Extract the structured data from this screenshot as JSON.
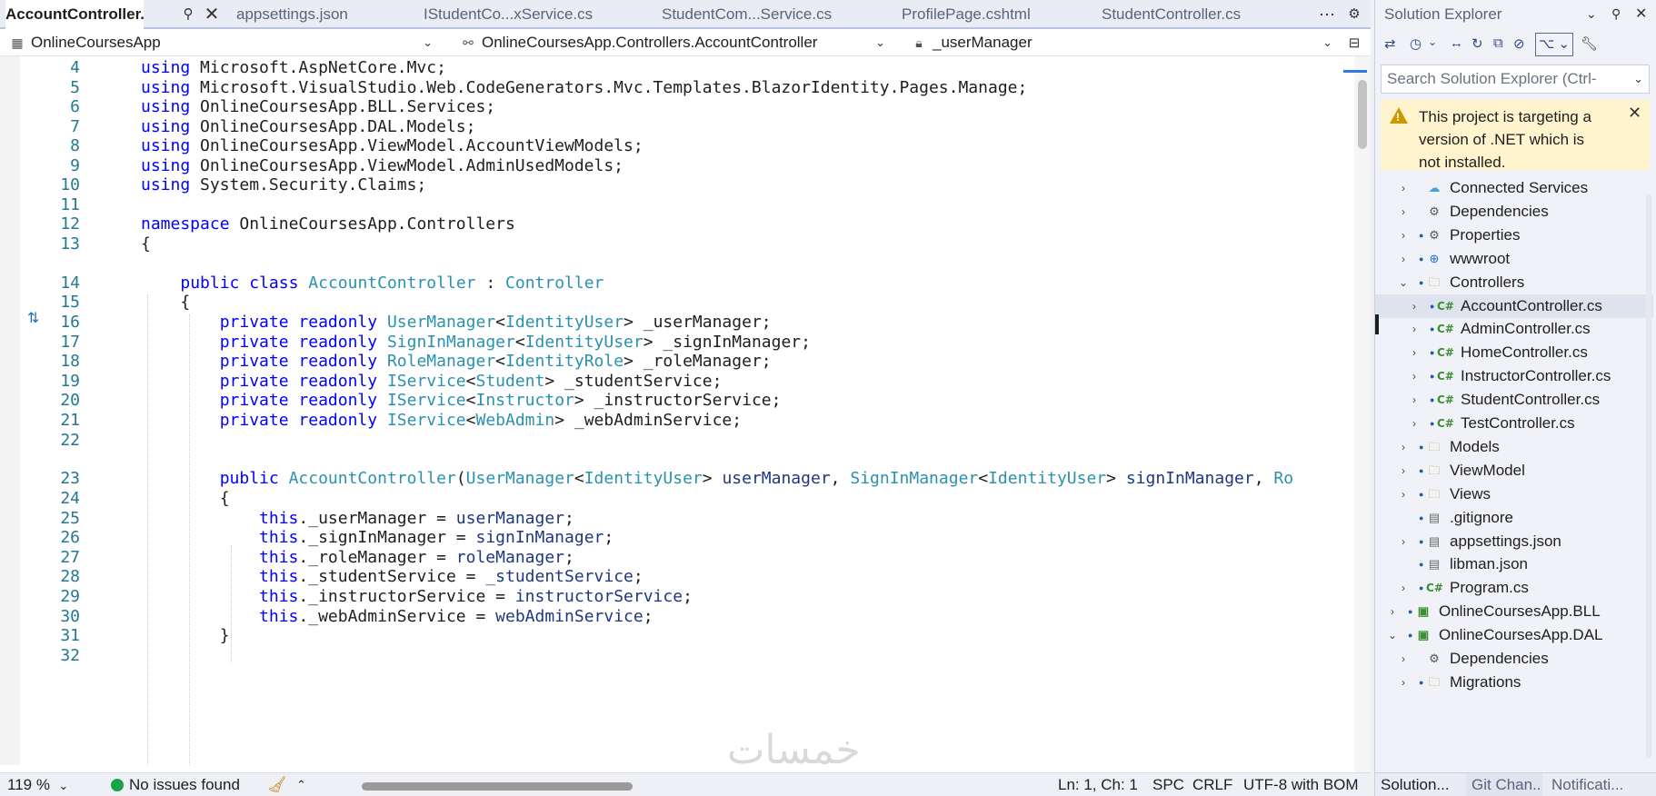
{
  "tabs": {
    "items": [
      {
        "label": "AccountController.cs",
        "active": true
      },
      {
        "label": "appsettings.json"
      },
      {
        "label": "IStudentCo...xService.cs"
      },
      {
        "label": "StudentCom...Service.cs"
      },
      {
        "label": "ProfilePage.cshtml"
      },
      {
        "label": "StudentController.cs"
      }
    ],
    "pin_icon": "pin-icon",
    "close_icon": "close-icon",
    "overflow_icon": "ellipsis-icon",
    "settings_icon": "gear-icon"
  },
  "nav": {
    "project": "OnlineCoursesApp",
    "type": "OnlineCoursesApp.Controllers.AccountController",
    "member": "_userManager"
  },
  "code": {
    "lines": [
      {
        "n": "4",
        "tokens": [
          [
            "kw",
            "using"
          ],
          [
            "pl",
            " Microsoft.AspNetCore.Mvc;"
          ]
        ]
      },
      {
        "n": "5",
        "tokens": [
          [
            "kw",
            "using"
          ],
          [
            "pl",
            " Microsoft.VisualStudio.Web.CodeGenerators.Mvc.Templates.BlazorIdentity.Pages.Manage;"
          ]
        ]
      },
      {
        "n": "6",
        "tokens": [
          [
            "kw",
            "using"
          ],
          [
            "pl",
            " OnlineCoursesApp.BLL.Services;"
          ]
        ]
      },
      {
        "n": "7",
        "tokens": [
          [
            "kw",
            "using"
          ],
          [
            "pl",
            " OnlineCoursesApp.DAL.Models;"
          ]
        ]
      },
      {
        "n": "8",
        "tokens": [
          [
            "kw",
            "using"
          ],
          [
            "pl",
            " OnlineCoursesApp.ViewModel.AccountViewModels;"
          ]
        ]
      },
      {
        "n": "9",
        "tokens": [
          [
            "kw",
            "using"
          ],
          [
            "pl",
            " OnlineCoursesApp.ViewModel.AdminUsedModels;"
          ]
        ]
      },
      {
        "n": "10",
        "tokens": [
          [
            "kw",
            "using"
          ],
          [
            "pl",
            " System.Security.Claims;"
          ]
        ]
      },
      {
        "n": "11",
        "tokens": []
      },
      {
        "n": "12",
        "tokens": [
          [
            "kw",
            "namespace"
          ],
          [
            "pl",
            " OnlineCoursesApp.Controllers"
          ]
        ]
      },
      {
        "n": "13",
        "tokens": [
          [
            "pl",
            "{"
          ]
        ]
      },
      {
        "n": "14",
        "tokens": [
          [
            "pl",
            "    "
          ],
          [
            "kw",
            "public"
          ],
          [
            "pl",
            " "
          ],
          [
            "kw",
            "class"
          ],
          [
            "pl",
            " "
          ],
          [
            "ty",
            "AccountController"
          ],
          [
            "pl",
            " : "
          ],
          [
            "ty",
            "Controller"
          ]
        ]
      },
      {
        "n": "15",
        "tokens": [
          [
            "pl",
            "    {"
          ]
        ]
      },
      {
        "n": "16",
        "tokens": [
          [
            "pl",
            "        "
          ],
          [
            "kw",
            "private"
          ],
          [
            "pl",
            " "
          ],
          [
            "kw",
            "readonly"
          ],
          [
            "pl",
            " "
          ],
          [
            "ty",
            "UserManager"
          ],
          [
            "pl",
            "<"
          ],
          [
            "ty",
            "IdentityUser"
          ],
          [
            "pl",
            "> _userManager;"
          ]
        ]
      },
      {
        "n": "17",
        "tokens": [
          [
            "pl",
            "        "
          ],
          [
            "kw",
            "private"
          ],
          [
            "pl",
            " "
          ],
          [
            "kw",
            "readonly"
          ],
          [
            "pl",
            " "
          ],
          [
            "ty",
            "SignInManager"
          ],
          [
            "pl",
            "<"
          ],
          [
            "ty",
            "IdentityUser"
          ],
          [
            "pl",
            "> _signInManager;"
          ]
        ]
      },
      {
        "n": "18",
        "tokens": [
          [
            "pl",
            "        "
          ],
          [
            "kw",
            "private"
          ],
          [
            "pl",
            " "
          ],
          [
            "kw",
            "readonly"
          ],
          [
            "pl",
            " "
          ],
          [
            "ty",
            "RoleManager"
          ],
          [
            "pl",
            "<"
          ],
          [
            "ty",
            "IdentityRole"
          ],
          [
            "pl",
            "> _roleManager;"
          ]
        ]
      },
      {
        "n": "19",
        "tokens": [
          [
            "pl",
            "        "
          ],
          [
            "kw",
            "private"
          ],
          [
            "pl",
            " "
          ],
          [
            "kw",
            "readonly"
          ],
          [
            "pl",
            " "
          ],
          [
            "ty",
            "IService"
          ],
          [
            "pl",
            "<"
          ],
          [
            "ty",
            "Student"
          ],
          [
            "pl",
            "> _studentService;"
          ]
        ]
      },
      {
        "n": "20",
        "tokens": [
          [
            "pl",
            "        "
          ],
          [
            "kw",
            "private"
          ],
          [
            "pl",
            " "
          ],
          [
            "kw",
            "readonly"
          ],
          [
            "pl",
            " "
          ],
          [
            "ty",
            "IService"
          ],
          [
            "pl",
            "<"
          ],
          [
            "ty",
            "Instructor"
          ],
          [
            "pl",
            "> _instructorService;"
          ]
        ]
      },
      {
        "n": "21",
        "tokens": [
          [
            "pl",
            "        "
          ],
          [
            "kw",
            "private"
          ],
          [
            "pl",
            " "
          ],
          [
            "kw",
            "readonly"
          ],
          [
            "pl",
            " "
          ],
          [
            "ty",
            "IService"
          ],
          [
            "pl",
            "<"
          ],
          [
            "ty",
            "WebAdmin"
          ],
          [
            "pl",
            "> _webAdminService;"
          ]
        ]
      },
      {
        "n": "22",
        "tokens": []
      },
      {
        "n": "23",
        "tokens": [
          [
            "pl",
            "        "
          ],
          [
            "kw",
            "public"
          ],
          [
            "pl",
            " "
          ],
          [
            "ty",
            "AccountController"
          ],
          [
            "pl",
            "("
          ],
          [
            "ty",
            "UserManager"
          ],
          [
            "pl",
            "<"
          ],
          [
            "ty",
            "IdentityUser"
          ],
          [
            "pl",
            "> "
          ],
          [
            "id",
            "userManager"
          ],
          [
            "pl",
            ", "
          ],
          [
            "ty",
            "SignInManager"
          ],
          [
            "pl",
            "<"
          ],
          [
            "ty",
            "IdentityUser"
          ],
          [
            "pl",
            "> "
          ],
          [
            "id",
            "signInManager"
          ],
          [
            "pl",
            ", "
          ],
          [
            "ty",
            "Ro"
          ]
        ]
      },
      {
        "n": "24",
        "tokens": [
          [
            "pl",
            "        {"
          ]
        ]
      },
      {
        "n": "25",
        "tokens": [
          [
            "pl",
            "            "
          ],
          [
            "kw",
            "this"
          ],
          [
            "pl",
            "._userManager = "
          ],
          [
            "id",
            "userManager"
          ],
          [
            "pl",
            ";"
          ]
        ]
      },
      {
        "n": "26",
        "tokens": [
          [
            "pl",
            "            "
          ],
          [
            "kw",
            "this"
          ],
          [
            "pl",
            "._signInManager = "
          ],
          [
            "id",
            "signInManager"
          ],
          [
            "pl",
            ";"
          ]
        ]
      },
      {
        "n": "27",
        "tokens": [
          [
            "pl",
            "            "
          ],
          [
            "kw",
            "this"
          ],
          [
            "pl",
            "._roleManager = "
          ],
          [
            "id",
            "roleManager"
          ],
          [
            "pl",
            ";"
          ]
        ]
      },
      {
        "n": "28",
        "tokens": [
          [
            "pl",
            "            "
          ],
          [
            "kw",
            "this"
          ],
          [
            "pl",
            "._studentService = "
          ],
          [
            "id",
            "_studentService"
          ],
          [
            "pl",
            ";"
          ]
        ]
      },
      {
        "n": "29",
        "tokens": [
          [
            "pl",
            "            "
          ],
          [
            "kw",
            "this"
          ],
          [
            "pl",
            "._instructorService = "
          ],
          [
            "id",
            "instructorService"
          ],
          [
            "pl",
            ";"
          ]
        ]
      },
      {
        "n": "30",
        "tokens": [
          [
            "pl",
            "            "
          ],
          [
            "kw",
            "this"
          ],
          [
            "pl",
            "._webAdminService = "
          ],
          [
            "id",
            "webAdminService"
          ],
          [
            "pl",
            ";"
          ]
        ]
      },
      {
        "n": "31",
        "tokens": [
          [
            "pl",
            "        }"
          ]
        ]
      },
      {
        "n": "32",
        "tokens": []
      }
    ]
  },
  "status": {
    "zoom": "119 %",
    "issues": "No issues found",
    "position": "Ln: 1, Ch: 1",
    "spacing": "SPC",
    "line_ending": "CRLF",
    "encoding": "UTF-8 with BOM"
  },
  "solution_explorer": {
    "title": "Solution Explorer",
    "search_placeholder": "Search Solution Explorer (Ctrl-",
    "warning": "This project is targeting a version of .NET which is not installed.",
    "tree": [
      {
        "label": "Connected Services",
        "icon": "cloud",
        "level": 2,
        "expander": "›"
      },
      {
        "label": "Dependencies",
        "icon": "gear",
        "level": 2,
        "expander": "›"
      },
      {
        "label": "Properties",
        "icon": "gear",
        "level": 2,
        "expander": "›",
        "lock": true
      },
      {
        "label": "wwwroot",
        "icon": "globe",
        "level": 2,
        "expander": "›",
        "lock": true
      },
      {
        "label": "Controllers",
        "icon": "folder",
        "level": 2,
        "expander": "⌄",
        "lock": true
      },
      {
        "label": "AccountController.cs",
        "icon": "cs",
        "level": 3,
        "expander": "›",
        "lock": true,
        "selected": true
      },
      {
        "label": "AdminController.cs",
        "icon": "cs",
        "level": 3,
        "expander": "›",
        "lock": true
      },
      {
        "label": "HomeController.cs",
        "icon": "cs",
        "level": 3,
        "expander": "›",
        "lock": true
      },
      {
        "label": "InstructorController.cs",
        "icon": "cs",
        "level": 3,
        "expander": "›",
        "lock": true
      },
      {
        "label": "StudentController.cs",
        "icon": "cs",
        "level": 3,
        "expander": "›",
        "lock": true
      },
      {
        "label": "TestController.cs",
        "icon": "cs",
        "level": 3,
        "expander": "›",
        "lock": true
      },
      {
        "label": "Models",
        "icon": "folder",
        "level": 2,
        "expander": "›",
        "lock": true
      },
      {
        "label": "ViewModel",
        "icon": "folder",
        "level": 2,
        "expander": "›",
        "lock": true
      },
      {
        "label": "Views",
        "icon": "folder",
        "level": 2,
        "expander": "›",
        "lock": true
      },
      {
        "label": ".gitignore",
        "icon": "file",
        "level": 2,
        "expander": "",
        "lock": true
      },
      {
        "label": "appsettings.json",
        "icon": "file",
        "level": 2,
        "expander": "›",
        "lock": true
      },
      {
        "label": "libman.json",
        "icon": "file",
        "level": 2,
        "expander": "",
        "lock": true
      },
      {
        "label": "Program.cs",
        "icon": "cs",
        "level": 2,
        "expander": "›",
        "lock": true
      },
      {
        "label": "OnlineCoursesApp.BLL",
        "icon": "proj",
        "level": 1,
        "expander": "›",
        "lock": true
      },
      {
        "label": "OnlineCoursesApp.DAL",
        "icon": "proj",
        "level": 1,
        "expander": "⌄",
        "lock": true
      },
      {
        "label": "Dependencies",
        "icon": "gear",
        "level": 2,
        "expander": "›"
      },
      {
        "label": "Migrations",
        "icon": "folder",
        "level": 2,
        "expander": "›",
        "lock": true
      }
    ],
    "bottom_tabs": [
      "Solution...",
      "Git Chan...",
      "Notificati..."
    ]
  },
  "colors": {
    "keyword": "#0000ff",
    "type": "#2b91af",
    "identifier": "#1f377f",
    "line_number": "#237893",
    "warning_bg": "#fff4ce",
    "ok": "#16a34a"
  },
  "watermark": "خمسات"
}
